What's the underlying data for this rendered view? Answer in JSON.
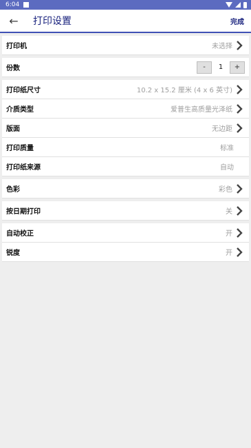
{
  "status": {
    "time": "6:04"
  },
  "header": {
    "title": "打印设置",
    "done_label": "完成"
  },
  "settings": [
    {
      "label": "打印机",
      "value": "未选择",
      "arrow": true
    },
    {
      "label": "份数",
      "value": "1",
      "minus": "-",
      "plus": "+"
    },
    {
      "label": "打印纸尺寸",
      "value": "10.2 x 15.2 厘米 (4 x 6 英寸)",
      "arrow": true
    },
    {
      "label": "介质类型",
      "value": "爱普生高质量光泽纸",
      "arrow": true
    },
    {
      "label": "版面",
      "value": "无边距",
      "arrow": true
    },
    {
      "label": "打印质量",
      "value": "标准",
      "arrow": false
    },
    {
      "label": "打印纸来源",
      "value": "自动",
      "arrow": false
    },
    {
      "label": "色彩",
      "value": "彩色",
      "arrow": true
    },
    {
      "label": "按日期打印",
      "value": "关",
      "arrow": true
    },
    {
      "label": "自动校正",
      "value": "开",
      "arrow": true
    },
    {
      "label": "锐度",
      "value": "开",
      "arrow": true
    }
  ]
}
